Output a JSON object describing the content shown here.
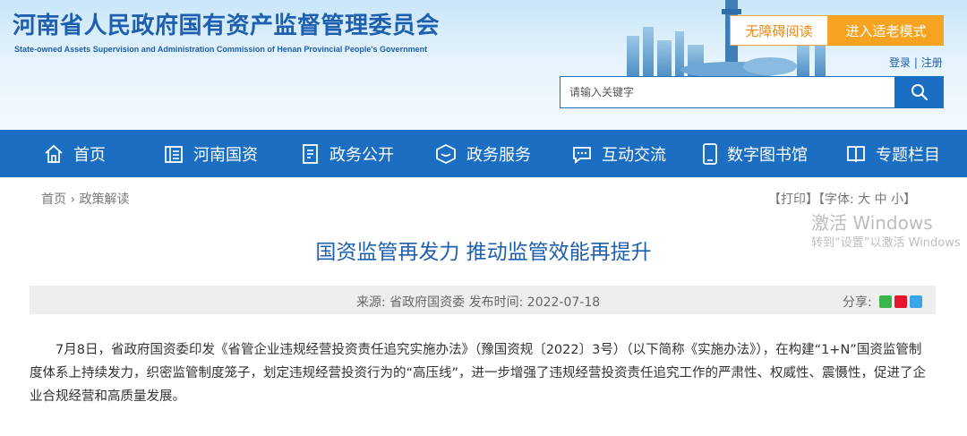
{
  "header": {
    "site_title": "河南省人民政府国有资产监督管理委员会",
    "site_subtitle": "State-owned Assets Supervision and Administration Commission of Henan Provincial People's Government",
    "accessible_reading": "无障碍阅读",
    "elder_mode": "进入适老模式",
    "login": "登录",
    "separator": "|",
    "register": "注册",
    "search_placeholder": "请输入关键字",
    "search_icon": "search-icon"
  },
  "nav": {
    "items": [
      {
        "label": "首页",
        "icon": "home-icon"
      },
      {
        "label": "河南国资",
        "icon": "building-icon"
      },
      {
        "label": "政务公开",
        "icon": "document-icon"
      },
      {
        "label": "政务服务",
        "icon": "service-icon"
      },
      {
        "label": "互动交流",
        "icon": "chat-icon"
      },
      {
        "label": "数字图书馆",
        "icon": "phone-icon"
      },
      {
        "label": "专题栏目",
        "icon": "book-icon"
      }
    ]
  },
  "breadcrumb": {
    "home": "首页",
    "sep": " › ",
    "current": "政策解读"
  },
  "tools": {
    "print": "【打印】",
    "font_label": "【字体: ",
    "large": "大",
    "medium": "中",
    "small": "小",
    "close": "】"
  },
  "article": {
    "title": "国资监管再发力 推动监管效能再提升",
    "meta": "来源: 省政府国资委 发布时间: 2022-07-18",
    "share_label": "分享:",
    "share_icons": [
      "wechat-icon",
      "weibo-icon",
      "qq-icon"
    ],
    "paragraph": "7月8日，省政府国资委印发《省管企业违规经营投资责任追究实施办法》（豫国资规〔2022〕3号）（以下简称《实施办法》），在构建“1+N”国资监管制度体系上持续发力，织密监管制度笼子，划定违规经营投资行为的“高压线”，进一步增强了违规经营投资责任追究工作的严肃性、权威性、震慑性，促进了企业合规经营和高质量发展。"
  },
  "os_watermark": {
    "line1": "激活 Windows",
    "line2": "转到“设置”以激活 Windows"
  },
  "colors": {
    "brand_blue": "#1b6ec2",
    "title_blue": "#1f5fb0",
    "accent_orange": "#f5a321"
  }
}
